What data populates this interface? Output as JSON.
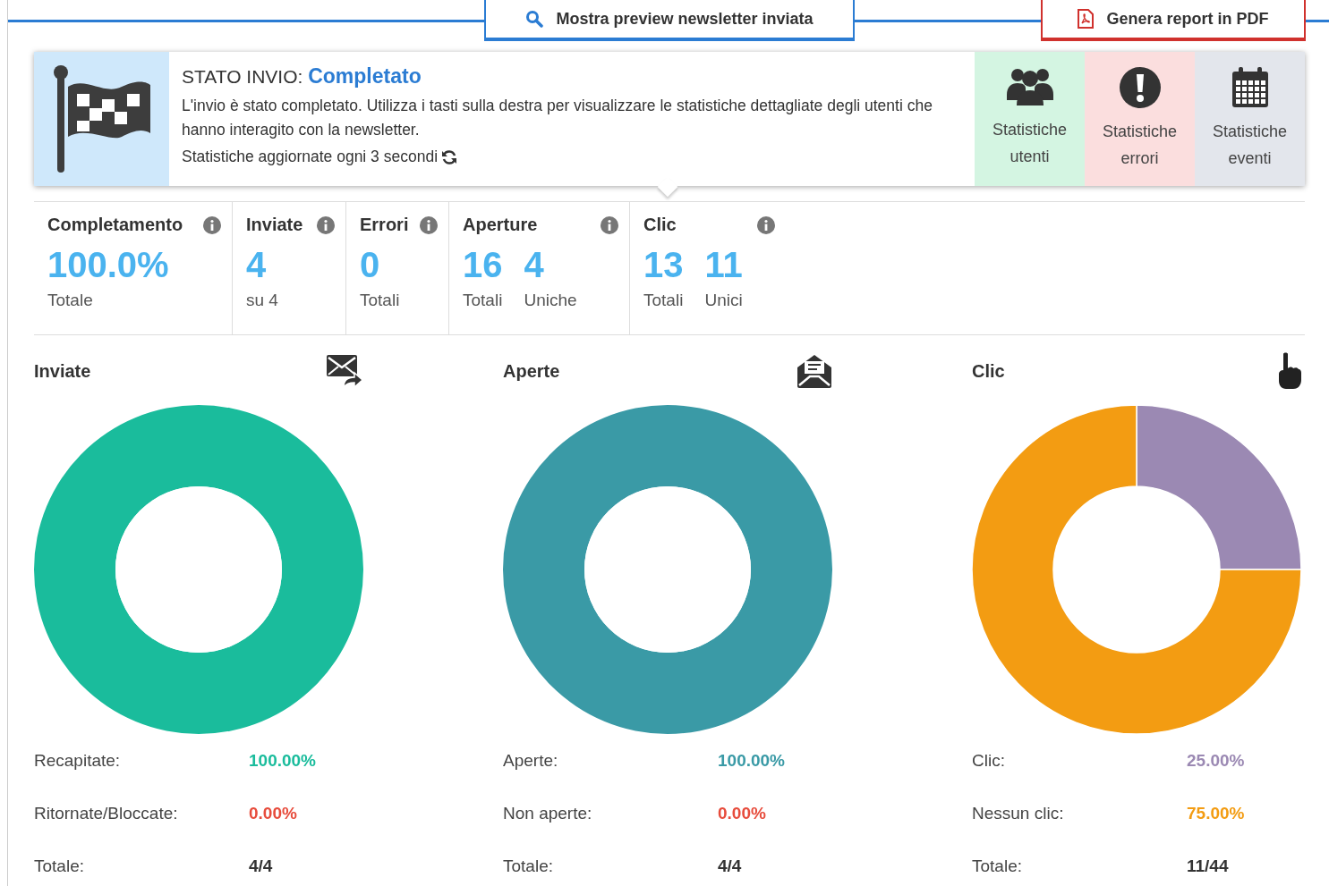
{
  "top_buttons": [
    {
      "label": "Mostra preview newsletter inviata",
      "kind": "preview"
    },
    {
      "label": "Genera report in PDF",
      "kind": "pdf"
    }
  ],
  "status": {
    "prefix": "STATO INVIO:",
    "state": "Completato",
    "description": "L'invio è stato completato. Utilizza i tasti sulla destra per visualizzare le statistiche dettagliate degli utenti che hanno interagito con la newsletter.",
    "update_note": "Statistiche aggiornate ogni 3 secondi"
  },
  "actions": [
    {
      "label": "Statistiche utenti",
      "kind": "users",
      "color": "#d4f5e2"
    },
    {
      "label": "Statistiche errori",
      "kind": "errors",
      "color": "#fbdede"
    },
    {
      "label": "Statistiche eventi",
      "kind": "events",
      "color": "#e3e6ec"
    }
  ],
  "metrics": [
    {
      "title": "Completamento",
      "values": [
        {
          "number": "100.0%",
          "caption": "Totale"
        }
      ]
    },
    {
      "title": "Inviate",
      "values": [
        {
          "number": "4",
          "caption": "su 4"
        }
      ]
    },
    {
      "title": "Errori",
      "values": [
        {
          "number": "0",
          "caption": "Totali"
        }
      ]
    },
    {
      "title": "Aperture",
      "values": [
        {
          "number": "16",
          "caption": "Totali"
        },
        {
          "number": "4",
          "caption": "Uniche"
        }
      ]
    },
    {
      "title": "Clic",
      "values": [
        {
          "number": "13",
          "caption": "Totali"
        },
        {
          "number": "11",
          "caption": "Unici"
        }
      ]
    }
  ],
  "charts": [
    {
      "title": "Inviate",
      "chart_data": {
        "type": "donut",
        "values": [
          100,
          0
        ]
      },
      "rows": [
        {
          "label": "Recapitate:",
          "value": "100.00%",
          "color": "#1abc9c"
        },
        {
          "label": "Ritornate/Bloccate:",
          "value": "0.00%",
          "color": "#e74c3c"
        },
        {
          "label": "Totale:",
          "value": "4/4",
          "color": "#333333"
        }
      ]
    },
    {
      "title": "Aperte",
      "chart_data": {
        "type": "donut",
        "values": [
          100,
          0
        ]
      },
      "rows": [
        {
          "label": "Aperte:",
          "value": "100.00%",
          "color": "#3a9aa6"
        },
        {
          "label": "Non aperte:",
          "value": "0.00%",
          "color": "#e74c3c"
        },
        {
          "label": "Totale:",
          "value": "4/4",
          "color": "#333333"
        }
      ]
    },
    {
      "title": "Clic",
      "chart_data": {
        "type": "donut",
        "values": [
          25,
          75
        ]
      },
      "rows": [
        {
          "label": "Clic:",
          "value": "25.00%",
          "color": "#9b89b3"
        },
        {
          "label": "Nessun clic:",
          "value": "75.00%",
          "color": "#f39c12"
        },
        {
          "label": "Totale:",
          "value": "11/44",
          "color": "#333333"
        }
      ]
    }
  ]
}
